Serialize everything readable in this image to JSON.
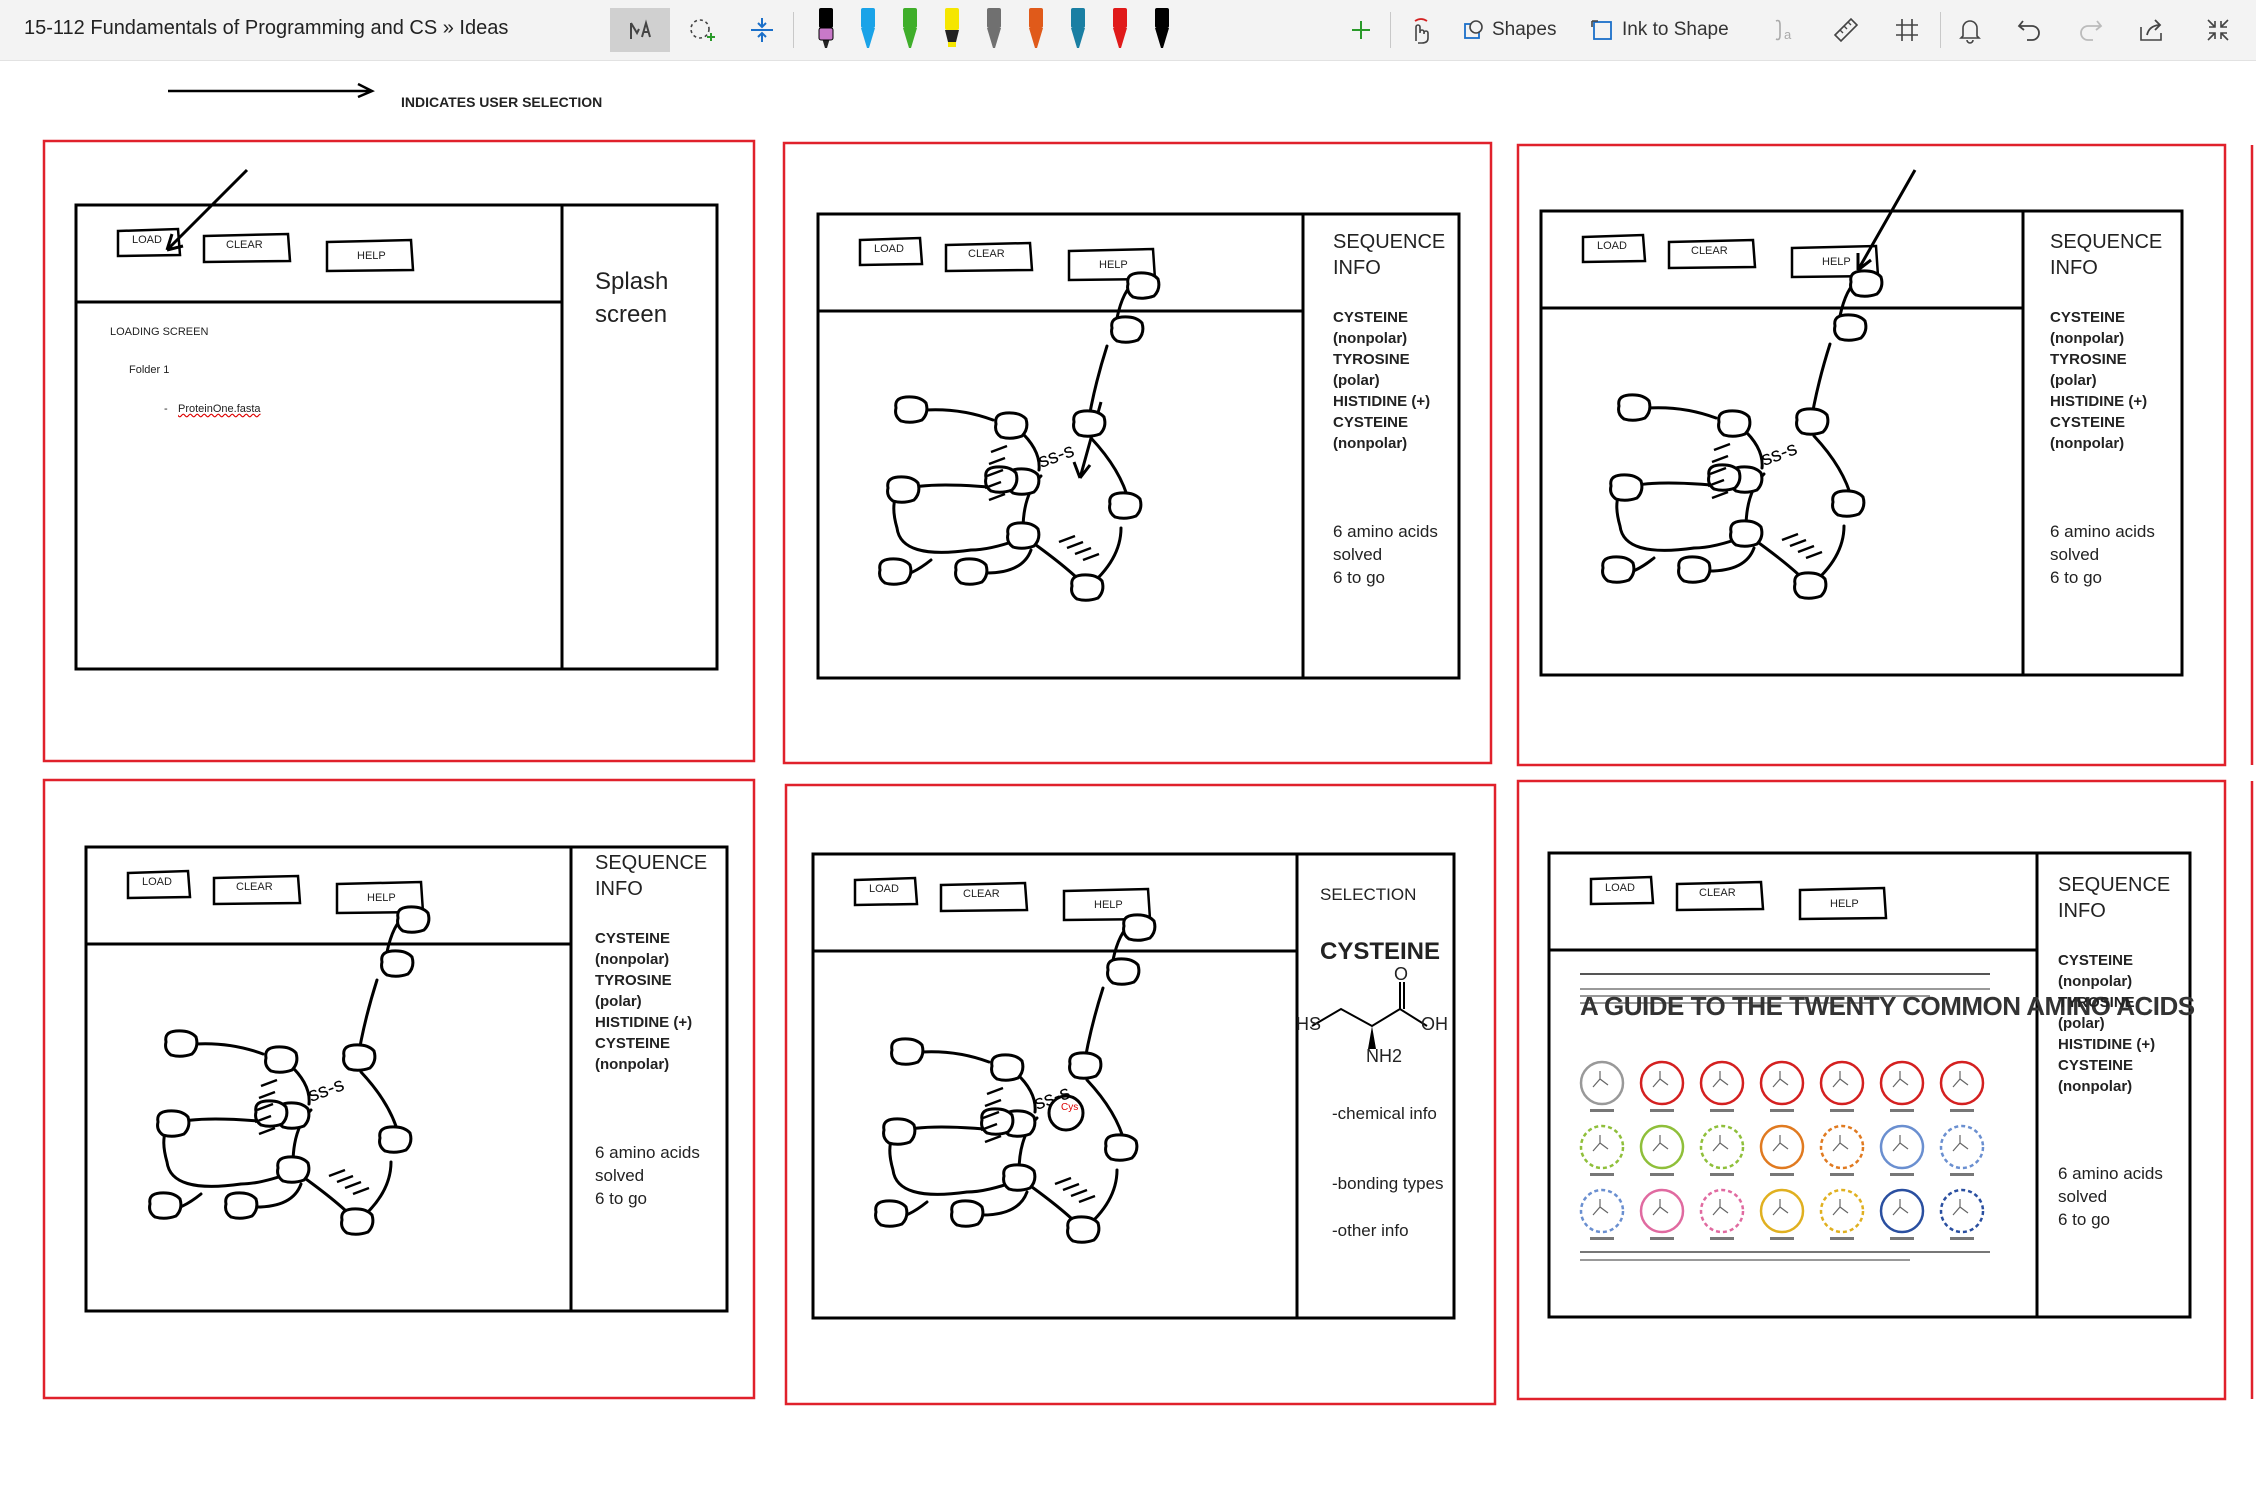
{
  "app": {
    "title": "15-112 Fundamentals of Programming and CS » Ideas"
  },
  "toolbar": {
    "shapes_label": "Shapes",
    "ink_to_shape_label": "Ink to Shape",
    "pens": [
      {
        "color": "#000000",
        "tip": "#c879c8"
      },
      {
        "color": "#1aa3e8",
        "tip": "#1aa3e8"
      },
      {
        "color": "#3fae2a",
        "tip": "#3fae2a"
      },
      {
        "color": "#f5e600",
        "tip": "#f5e600"
      },
      {
        "color": "#707070",
        "tip": "#707070"
      },
      {
        "color": "#e05a1a",
        "tip": "#e05a1a"
      },
      {
        "color": "#1a7fa3",
        "tip": "#1a7fa3"
      },
      {
        "color": "#e01a1a",
        "tip": "#e01a1a"
      },
      {
        "color": "#000000",
        "tip": "#000000"
      }
    ],
    "icons": [
      "ink-text-icon",
      "lasso-select-icon",
      "space-icon",
      "add-pen-icon",
      "touch-draw-icon",
      "shapes-icon",
      "ink-to-shape-icon",
      "ink-to-math-icon",
      "ruler-icon",
      "grid-icon",
      "bell-icon",
      "undo-icon",
      "redo-icon",
      "share-icon",
      "collapse-icon"
    ]
  },
  "legend": {
    "text": "INDICATES USER SELECTION"
  },
  "colors": {
    "frame": "#e0212b",
    "ink": "#000000"
  },
  "panels": [
    {
      "buttons": [
        "LOAD",
        "CLEAR",
        "HELP"
      ],
      "loading_screen": "LOADING SCREEN",
      "folder": "Folder 1",
      "file_bullet": "-",
      "file": "ProteinOne.fasta",
      "sidebar": "Splash\nscreen"
    },
    {
      "buttons": [
        "LOAD",
        "CLEAR",
        "HELP"
      ],
      "sidebar_title": "SEQUENCE\nINFO",
      "sidebar_list": "CYSTEINE\n(nonpolar)\nTYROSINE\n(polar)\nHISTIDINE (+)\nCYSTEINE\n(nonpolar)",
      "sidebar_count": "6 amino acids\nsolved\n6 to go"
    },
    {
      "buttons": [
        "LOAD",
        "CLEAR",
        "HELP"
      ],
      "sidebar_title": "SEQUENCE\nINFO",
      "sidebar_list": "CYSTEINE\n(nonpolar)\nTYROSINE\n(polar)\nHISTIDINE (+)\nCYSTEINE\n(nonpolar)",
      "sidebar_count": "6 amino acids\nsolved\n6 to go"
    },
    {
      "buttons": [
        "LOAD",
        "CLEAR",
        "HELP"
      ],
      "sidebar_title": "SEQUENCE\nINFO",
      "sidebar_list": "CYSTEINE\n(nonpolar)\nTYROSINE\n(polar)\nHISTIDINE (+)\nCYSTEINE\n(nonpolar)",
      "sidebar_count": "6 amino acids\nsolved\n6 to go"
    },
    {
      "buttons": [
        "LOAD",
        "CLEAR",
        "HELP"
      ],
      "selection_title": "SELECTION",
      "selection_name": "CYSTEINE",
      "atoms": [
        "HS",
        "O",
        "OH",
        "NH2"
      ],
      "circle_label": "Cys",
      "info": [
        "-chemical info",
        "-bonding types",
        "-other info"
      ]
    },
    {
      "buttons": [
        "LOAD",
        "CLEAR",
        "HELP"
      ],
      "guide_title": "A GUIDE TO THE TWENTY COMMON AMINO ACIDS",
      "sidebar_title": "SEQUENCE\nINFO",
      "sidebar_list": "CYSTEINE\n(nonpolar)\nTYROSINE\n(polar)\nHISTIDINE (+)\nCYSTEINE\n(nonpolar)",
      "sidebar_count": "6 amino acids\nsolved\n6 to go"
    }
  ]
}
